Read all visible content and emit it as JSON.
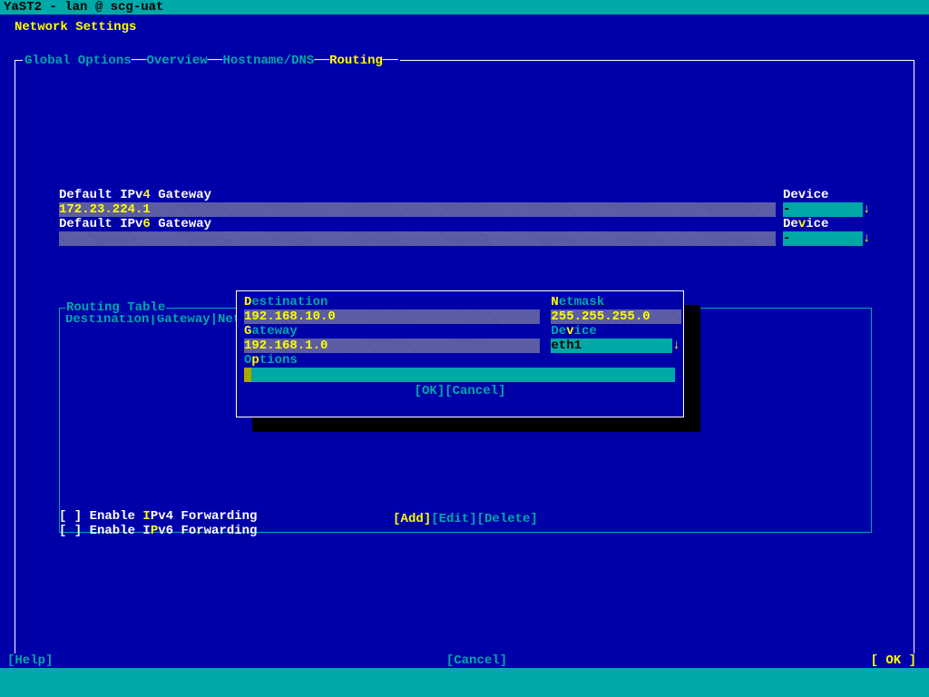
{
  "titlebar": "YaST2 - lan @ scg-uat",
  "page_title": "Network Settings",
  "tabs": {
    "global": "Global Options",
    "overview": "Overview",
    "hostname": "Hostname/DNS",
    "routing": "Routing"
  },
  "ipv4gw": {
    "label_pre": "Default IPv",
    "label_hk": "4",
    "label_post": " Gateway",
    "value": "172.23.224.1",
    "device_label": "Device",
    "device_value": "-"
  },
  "ipv6gw": {
    "label_pre": "Default IPv",
    "label_hk": "6",
    "label_post": " Gateway",
    "value": "",
    "device_label_pre": "De",
    "device_label_hk": "v",
    "device_label_post": "ice",
    "device_value": "-"
  },
  "routing_table": {
    "title": "Routing Table",
    "header": "Destination|Gateway|Net",
    "buttons": {
      "add_pre": "[A",
      "add_hk": "d",
      "add_post": "d]",
      "edit": "[Edit]",
      "delete": "[Delete]"
    }
  },
  "dialog": {
    "dest_label_hk": "D",
    "dest_label": "estination",
    "dest_value": "192.168.10.0",
    "netmask_label_hk": "N",
    "netmask_label": "etmask",
    "netmask_value": "255.255.255.0",
    "gateway_label_hk": "G",
    "gateway_label": "ateway",
    "gateway_value": "192.168.1.0",
    "device_label": "De",
    "device_label_hk": "v",
    "device_label_post": "ice",
    "device_value": "eth1",
    "options_label": "O",
    "options_label_hk": "p",
    "options_label_post": "tions",
    "ok": "[OK]",
    "cancel": "[Cancel]"
  },
  "checkboxes": {
    "ipv4_pre": "[ ] Enable ",
    "ipv4_hk": "I",
    "ipv4_post": "Pv4 Forwarding",
    "ipv6_pre": "[ ] Enable I",
    "ipv6_hk": "P",
    "ipv6_post": "v6 Forwarding"
  },
  "bottom": {
    "help": "[Help]",
    "cancel": "[Cancel]",
    "ok": "[ OK ]"
  }
}
